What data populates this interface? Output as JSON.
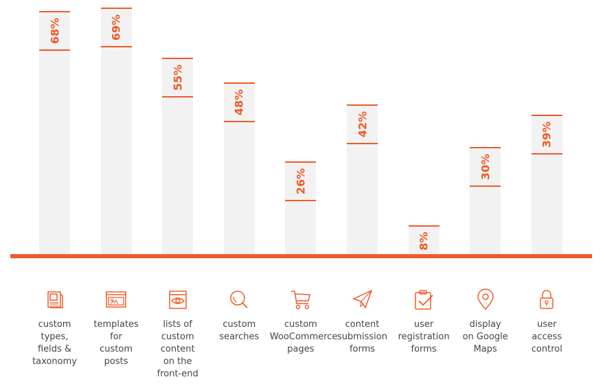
{
  "colors": {
    "accent": "#f05a28",
    "bar": "#f2f2f2",
    "text": "#444444"
  },
  "chart_data": {
    "type": "bar",
    "title": "",
    "xlabel": "",
    "ylabel": "",
    "ylim": [
      0,
      70
    ],
    "grid": false,
    "categories": [
      "custom types, fields & taxonomy",
      "templates for custom posts",
      "lists of custom content on the front-end",
      "custom searches",
      "custom WooCommerce pages",
      "content submission forms",
      "user registration forms",
      "display on Google Maps",
      "user access control"
    ],
    "values": [
      68,
      69,
      55,
      48,
      26,
      42,
      8,
      30,
      39
    ],
    "value_labels": [
      "68%",
      "69%",
      "55%",
      "48%",
      "26%",
      "42%",
      "8%",
      "30%",
      "39%"
    ]
  },
  "categories": [
    {
      "icon": "document-icon",
      "lines": [
        "custom",
        "types,",
        "fields &",
        "taxonomy"
      ]
    },
    {
      "icon": "template-image-icon",
      "lines": [
        "templates",
        "for",
        "custom",
        "posts"
      ]
    },
    {
      "icon": "view-eye-icon",
      "lines": [
        "lists of",
        "custom",
        "content",
        "on the",
        "front-end"
      ]
    },
    {
      "icon": "search-icon",
      "lines": [
        "custom",
        "searches"
      ]
    },
    {
      "icon": "shopping-cart-icon",
      "lines": [
        "custom",
        "WooCommerce",
        "pages"
      ]
    },
    {
      "icon": "paper-plane-icon",
      "lines": [
        "content",
        "submission",
        "forms"
      ]
    },
    {
      "icon": "clipboard-check-icon",
      "lines": [
        "user",
        "registration",
        "forms"
      ]
    },
    {
      "icon": "map-pin-icon",
      "lines": [
        "display",
        "on Google",
        "Maps"
      ]
    },
    {
      "icon": "lock-icon",
      "lines": [
        "user",
        "access",
        "control"
      ]
    }
  ]
}
